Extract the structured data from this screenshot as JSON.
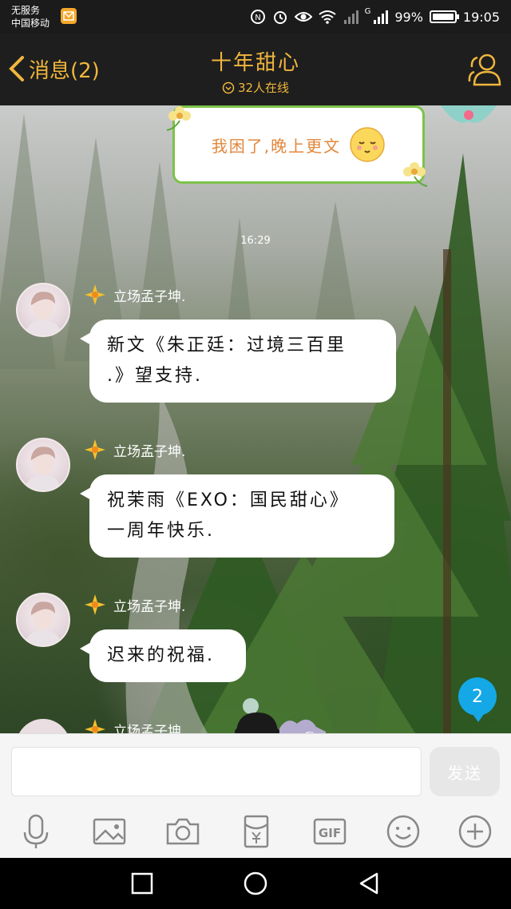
{
  "status_bar": {
    "carrier_line1": "无服务",
    "carrier_line2": "中国移动",
    "network_label": "G",
    "battery_percent": "99%",
    "time": "19:05"
  },
  "header": {
    "back_label": "消息(2)",
    "title": "十年甜心",
    "online_status": "32人在线"
  },
  "chat": {
    "sticker_text": "我困了,晚上更文",
    "timestamp": "16:29",
    "messages": [
      {
        "sender": "立场孟子坤.",
        "lines": [
          "新文《朱正廷：过境三百里",
          ".》望支持."
        ]
      },
      {
        "sender": "立场孟子坤.",
        "lines": [
          "祝茉雨《EXO：国民甜心》",
          "一周年快乐."
        ]
      },
      {
        "sender": "立场孟子坤.",
        "lines": [
          "迟来的祝福."
        ]
      }
    ],
    "partial_sender": "立场孟子坤.",
    "unread_count": "2",
    "sticker_tag": "我"
  },
  "input": {
    "placeholder": "",
    "send_label": "发送"
  },
  "toolbar": {
    "gif_label": "GIF",
    "icons": [
      "microphone-icon",
      "image-icon",
      "camera-icon",
      "red-packet-icon",
      "gif-icon",
      "emoji-icon",
      "plus-icon"
    ]
  },
  "colors": {
    "accent": "#f0b63d",
    "header_bg": "#1e1e1e",
    "badge": "#14a8e6"
  }
}
